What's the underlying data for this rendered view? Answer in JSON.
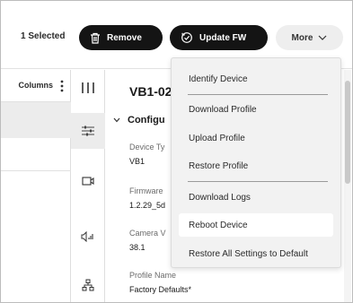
{
  "toolbar": {
    "selected_count": "1 Selected",
    "remove_label": "Remove",
    "update_label": "Update FW",
    "more_label": "More"
  },
  "left_panel": {
    "columns_label": "Columns"
  },
  "icon_rail": {
    "items": [
      "columns-icon",
      "sliders-icon",
      "camera-icon",
      "audio-icon",
      "network-icon"
    ]
  },
  "detail": {
    "device_name": "VB1-02",
    "section_title": "Configu",
    "fields": [
      {
        "label": "Device Ty",
        "value": "VB1"
      },
      {
        "label": "Firmware",
        "value": "1.2.29_5d"
      },
      {
        "label": "Camera V",
        "value": "38.1"
      },
      {
        "label": "Profile Name",
        "value": "Factory Defaults*"
      }
    ]
  },
  "menu": {
    "items": [
      "Identify Device",
      "Download Profile",
      "Upload Profile",
      "Restore Profile",
      "Download Logs",
      "Reboot Device",
      "Restore All Settings to Default"
    ],
    "hovered_item": "Reboot Device"
  },
  "colors": {
    "primary_button": "#141414",
    "secondary_button": "#eeeeee",
    "menu_background": "#f2f2f2",
    "selected_row": "#ececec"
  }
}
